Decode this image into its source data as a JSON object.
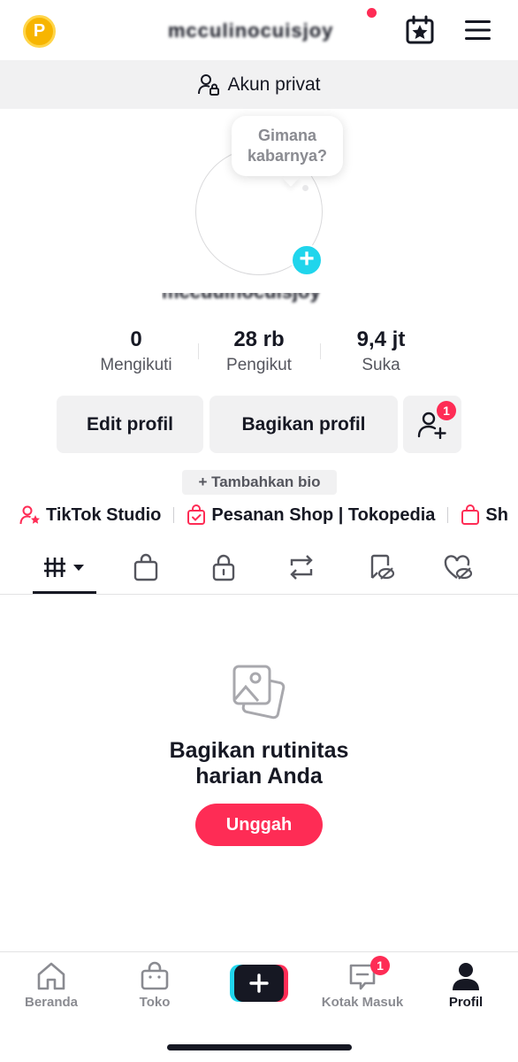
{
  "header": {
    "coin_letter": "P",
    "username": "mcculinocuisjoy"
  },
  "private_banner": {
    "label": "Akun privat"
  },
  "avatar": {
    "bubble_text": "Gimana kabarnya?",
    "add_symbol": "+",
    "display_name": "mccuuinocuisjoy"
  },
  "stats": [
    {
      "value": "0",
      "label": "Mengikuti"
    },
    {
      "value": "28 rb",
      "label": "Pengikut"
    },
    {
      "value": "9,4 jt",
      "label": "Suka"
    }
  ],
  "actions": {
    "edit_profile": "Edit profil",
    "share_profile": "Bagikan profil",
    "add_friends_badge": "1"
  },
  "bio_button": "+ Tambahkan bio",
  "links": [
    {
      "label": "TikTok Studio",
      "icon": "person-star-icon"
    },
    {
      "label": "Pesanan Shop | Tokopedia",
      "icon": "shop-bag-check-icon"
    },
    {
      "label": "Sh",
      "icon": "shop-bag-icon"
    }
  ],
  "tabs": [
    {
      "icon": "grid-videos-icon",
      "active": true
    },
    {
      "icon": "shop-bag-icon"
    },
    {
      "icon": "lock-icon"
    },
    {
      "icon": "repost-icon"
    },
    {
      "icon": "favorites-hidden-icon"
    },
    {
      "icon": "liked-hidden-icon"
    }
  ],
  "empty_state": {
    "icon": "photos-icon",
    "title_line1": "Bagikan rutinitas",
    "title_line2": "harian Anda",
    "upload_label": "Unggah"
  },
  "bottom_nav": {
    "home": "Beranda",
    "shop": "Toko",
    "create": "+",
    "inbox": "Kotak Masuk",
    "inbox_badge": "1",
    "profile": "Profil"
  },
  "colors": {
    "accent": "#fe2c55",
    "cyan": "#20d5ec",
    "text": "#161823",
    "muted": "#8a8b91",
    "surface": "#f1f1f2"
  }
}
